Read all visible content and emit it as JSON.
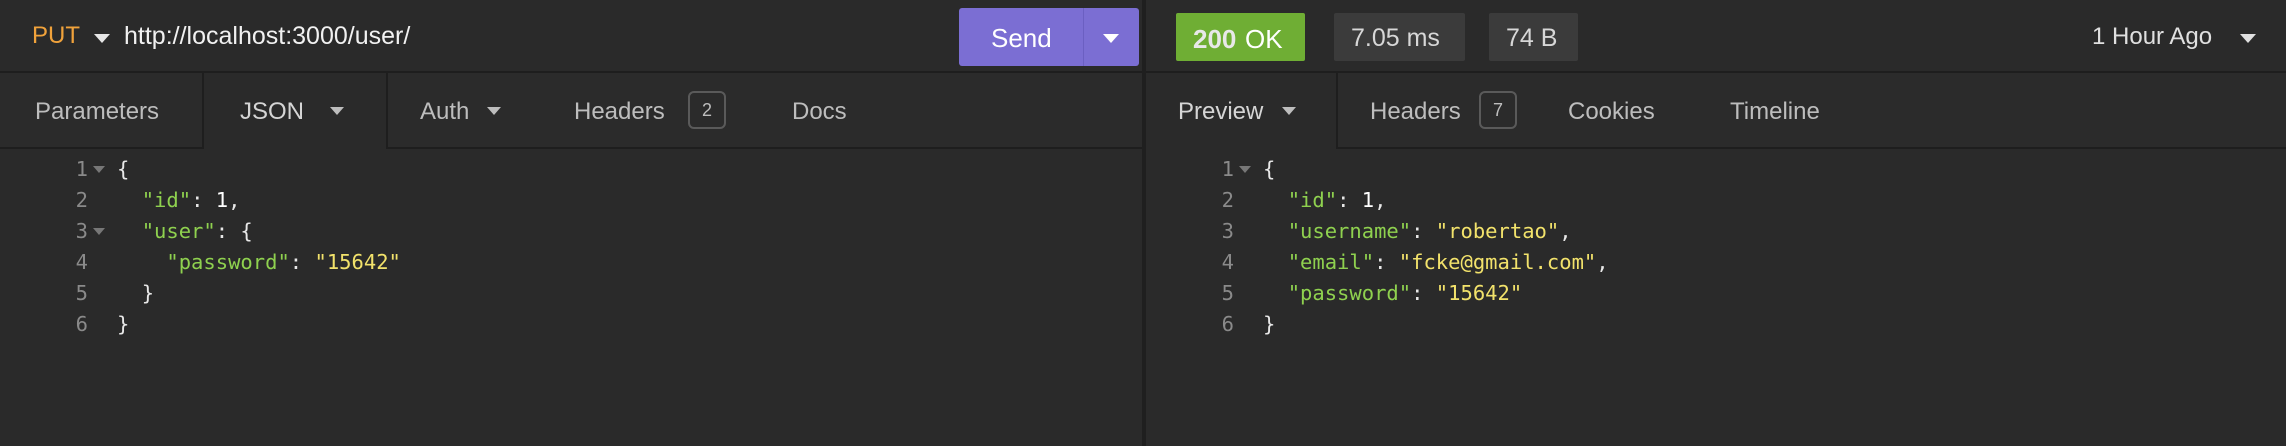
{
  "request": {
    "method": "PUT",
    "url": "http://localhost:3000/user/",
    "send_label": "Send",
    "tabs": [
      {
        "label": "Parameters"
      },
      {
        "label": "JSON"
      },
      {
        "label": "Auth"
      },
      {
        "label": "Headers",
        "badge": "2"
      },
      {
        "label": "Docs"
      }
    ],
    "body_lines": [
      {
        "n": "1",
        "fold": true,
        "indent": "",
        "parts": [
          {
            "t": "p",
            "v": "{"
          }
        ]
      },
      {
        "n": "2",
        "fold": false,
        "indent": "  ",
        "parts": [
          {
            "t": "k",
            "v": "\"id\""
          },
          {
            "t": "p",
            "v": ": "
          },
          {
            "t": "n",
            "v": "1"
          },
          {
            "t": "p",
            "v": ","
          }
        ]
      },
      {
        "n": "3",
        "fold": true,
        "indent": "  ",
        "parts": [
          {
            "t": "k",
            "v": "\"user\""
          },
          {
            "t": "p",
            "v": ": {"
          }
        ]
      },
      {
        "n": "4",
        "fold": false,
        "indent": "    ",
        "parts": [
          {
            "t": "k",
            "v": "\"password\""
          },
          {
            "t": "p",
            "v": ": "
          },
          {
            "t": "s",
            "v": "\"15642\""
          }
        ]
      },
      {
        "n": "5",
        "fold": false,
        "indent": "  ",
        "parts": [
          {
            "t": "p",
            "v": "}"
          }
        ]
      },
      {
        "n": "6",
        "fold": false,
        "indent": "",
        "parts": [
          {
            "t": "p",
            "v": "}"
          }
        ]
      }
    ]
  },
  "response": {
    "status_code": "200",
    "status_text": "OK",
    "time": "7.05 ms",
    "size": "74 B",
    "history": "1 Hour Ago",
    "tabs": [
      {
        "label": "Preview"
      },
      {
        "label": "Headers",
        "badge": "7"
      },
      {
        "label": "Cookies"
      },
      {
        "label": "Timeline"
      }
    ],
    "body_lines": [
      {
        "n": "1",
        "fold": true,
        "indent": "",
        "parts": [
          {
            "t": "p",
            "v": "{"
          }
        ]
      },
      {
        "n": "2",
        "fold": false,
        "indent": "  ",
        "parts": [
          {
            "t": "k",
            "v": "\"id\""
          },
          {
            "t": "p",
            "v": ": "
          },
          {
            "t": "n",
            "v": "1"
          },
          {
            "t": "p",
            "v": ","
          }
        ]
      },
      {
        "n": "3",
        "fold": false,
        "indent": "  ",
        "parts": [
          {
            "t": "k",
            "v": "\"username\""
          },
          {
            "t": "p",
            "v": ": "
          },
          {
            "t": "s",
            "v": "\"robertao\""
          },
          {
            "t": "p",
            "v": ","
          }
        ]
      },
      {
        "n": "4",
        "fold": false,
        "indent": "  ",
        "parts": [
          {
            "t": "k",
            "v": "\"email\""
          },
          {
            "t": "p",
            "v": ": "
          },
          {
            "t": "s",
            "v": "\"fcke@gmail.com\""
          },
          {
            "t": "p",
            "v": ","
          }
        ]
      },
      {
        "n": "5",
        "fold": false,
        "indent": "  ",
        "parts": [
          {
            "t": "k",
            "v": "\"password\""
          },
          {
            "t": "p",
            "v": ": "
          },
          {
            "t": "s",
            "v": "\"15642\""
          }
        ]
      },
      {
        "n": "6",
        "fold": false,
        "indent": "",
        "parts": [
          {
            "t": "p",
            "v": "}"
          }
        ]
      }
    ]
  },
  "colors": {
    "method": "#f0a23b",
    "send_button": "#7b6ed3",
    "status_ok": "#6fae34",
    "json_key": "#8fd14f",
    "json_string": "#f2e26b"
  }
}
